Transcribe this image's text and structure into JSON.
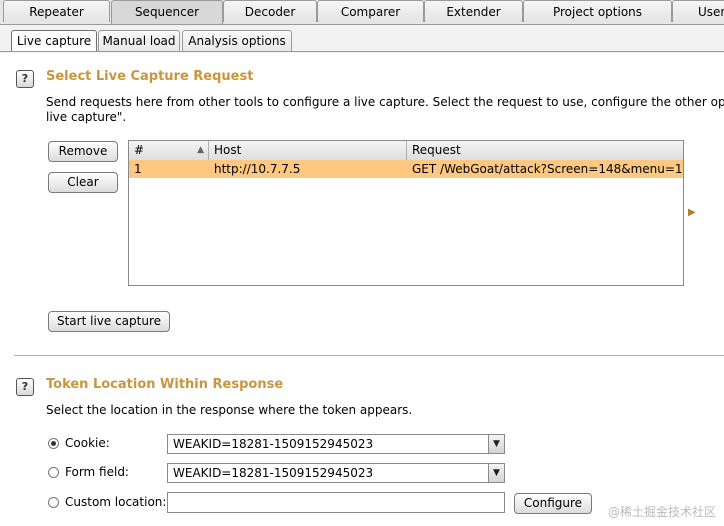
{
  "top_tabs": [
    "Repeater",
    "Sequencer",
    "Decoder",
    "Comparer",
    "Extender",
    "Project options",
    "User"
  ],
  "sub_tabs": [
    "Live capture",
    "Manual load",
    "Analysis options"
  ],
  "help_glyph": "?",
  "live_capture": {
    "title": "Select Live Capture Request",
    "description_line1": "Send requests here from other tools to configure a live capture. Select the request to use, configure the other options",
    "description_line2": "live capture\".",
    "remove_label": "Remove",
    "clear_label": "Clear",
    "table": {
      "columns": [
        "#",
        "Host",
        "Request"
      ],
      "rows": [
        {
          "num": "1",
          "host": "http://10.7.7.5",
          "request": "GET /WebGoat/attack?Screen=148&menu=1..."
        }
      ]
    },
    "start_label": "Start live capture"
  },
  "token_location": {
    "title": "Token Location Within Response",
    "description": "Select the location in the response where the token appears.",
    "cookie_label": "Cookie:",
    "cookie_value": "WEAKID=18281-1509152945023",
    "form_field_label": "Form field:",
    "form_field_value": "WEAKID=18281-1509152945023",
    "custom_location_label": "Custom location:",
    "custom_location_value": "",
    "configure_label": "Configure",
    "selected_option": "cookie"
  },
  "watermark": "@稀土掘金技术社区",
  "colors": {
    "title": "#c8963c",
    "selected_row": "#ffc880"
  }
}
